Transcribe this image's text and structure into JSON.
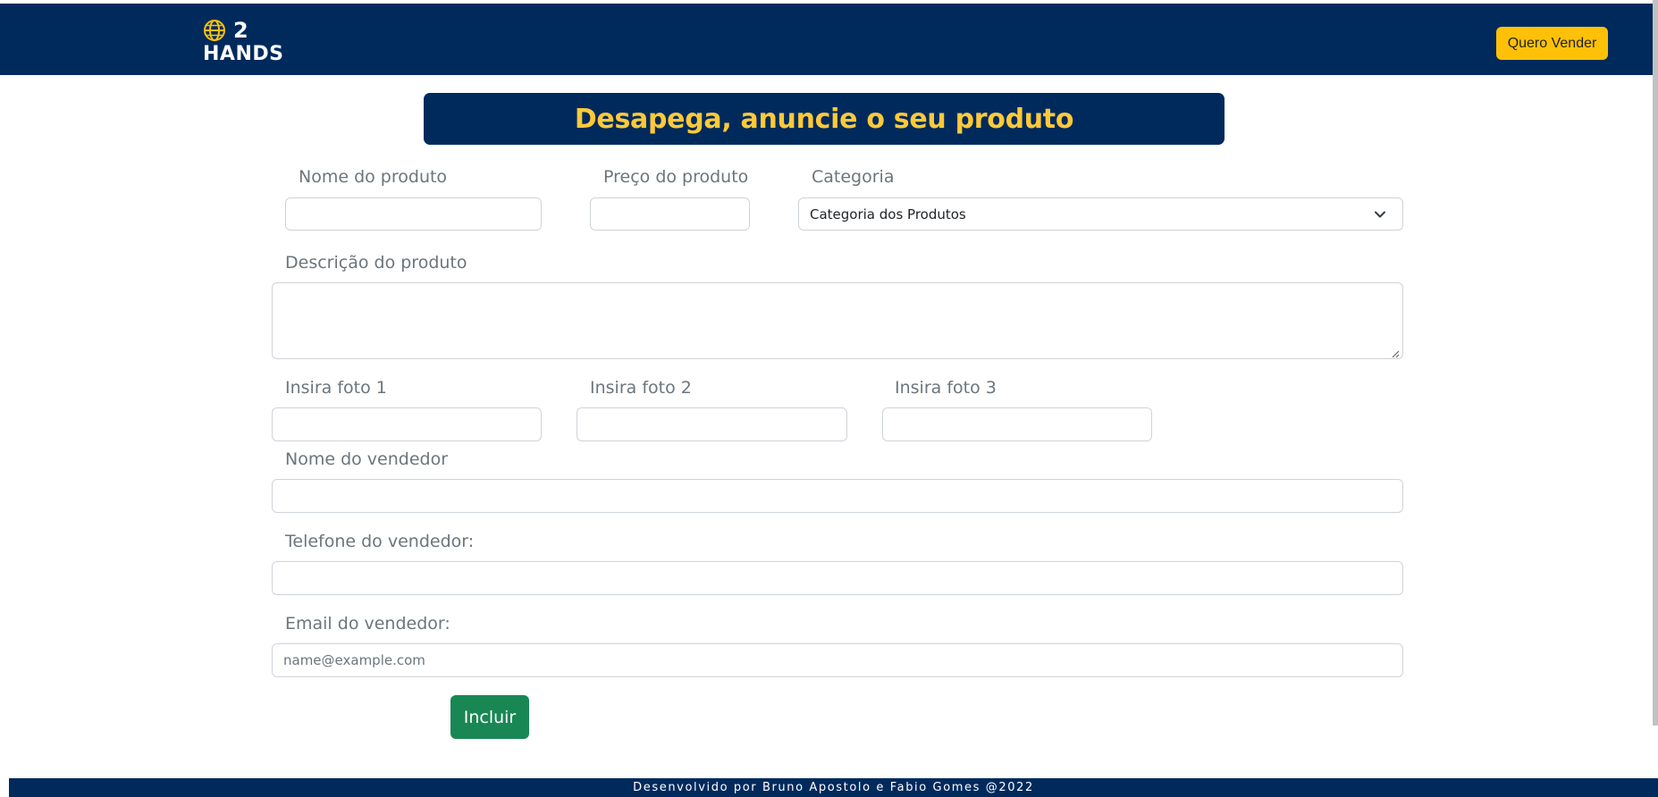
{
  "header": {
    "logo_number": "2",
    "logo_word": "HANDS",
    "logo_icon": "globe-icon",
    "sell_button_label": "Quero Vender"
  },
  "banner": {
    "title": "Desapega, anuncie o seu produto"
  },
  "form": {
    "product_name": {
      "label": "Nome do produto",
      "value": ""
    },
    "product_price": {
      "label": "Preço do produto",
      "value": ""
    },
    "category": {
      "label": "Categoria",
      "selected": "Categoria dos Produtos"
    },
    "description": {
      "label": "Descrição do produto",
      "value": ""
    },
    "photo1": {
      "label": "Insira foto 1",
      "value": ""
    },
    "photo2": {
      "label": "Insira foto 2",
      "value": ""
    },
    "photo3": {
      "label": "Insira foto 3",
      "value": ""
    },
    "seller_name": {
      "label": "Nome do vendedor",
      "value": ""
    },
    "seller_phone": {
      "label": "Telefone do vendedor:",
      "value": ""
    },
    "seller_email": {
      "label": "Email do vendedor:",
      "placeholder": "name@example.com",
      "value": ""
    },
    "submit_label": "Incluir"
  },
  "footer": {
    "text": "Desenvolvido por Bruno Apostolo e Fabio Gomes @2022"
  },
  "colors": {
    "navy": "#002a5c",
    "accent_yellow": "#ffc107",
    "banner_text": "#ffc93a",
    "submit_green": "#198754"
  }
}
